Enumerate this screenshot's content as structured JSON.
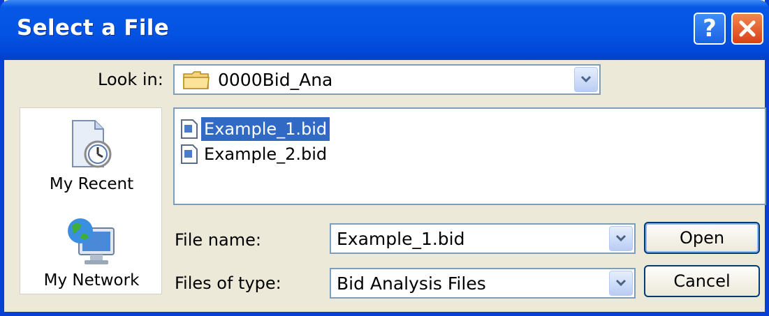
{
  "dialog": {
    "title": "Select a File",
    "help_icon": "help-icon",
    "close_icon": "close-icon"
  },
  "look_in": {
    "label": "Look in:",
    "value": "0000Bid_Ana",
    "icon": "folder-icon"
  },
  "places": [
    {
      "label": "My Recent",
      "icon": "recent-documents-icon"
    },
    {
      "label": "My Network",
      "icon": "network-icon"
    }
  ],
  "files": [
    {
      "name": "Example_1.bid",
      "selected": true
    },
    {
      "name": "Example_2.bid",
      "selected": false
    }
  ],
  "file_name": {
    "label": "File name:",
    "value": "Example_1.bid"
  },
  "file_type": {
    "label": "Files of type:",
    "value": "Bid Analysis Files"
  },
  "buttons": {
    "open": "Open",
    "cancel": "Cancel"
  },
  "colors": {
    "titlebar": "#0454e4",
    "selection": "#316ac5",
    "dialog_bg": "#ece9d8"
  }
}
